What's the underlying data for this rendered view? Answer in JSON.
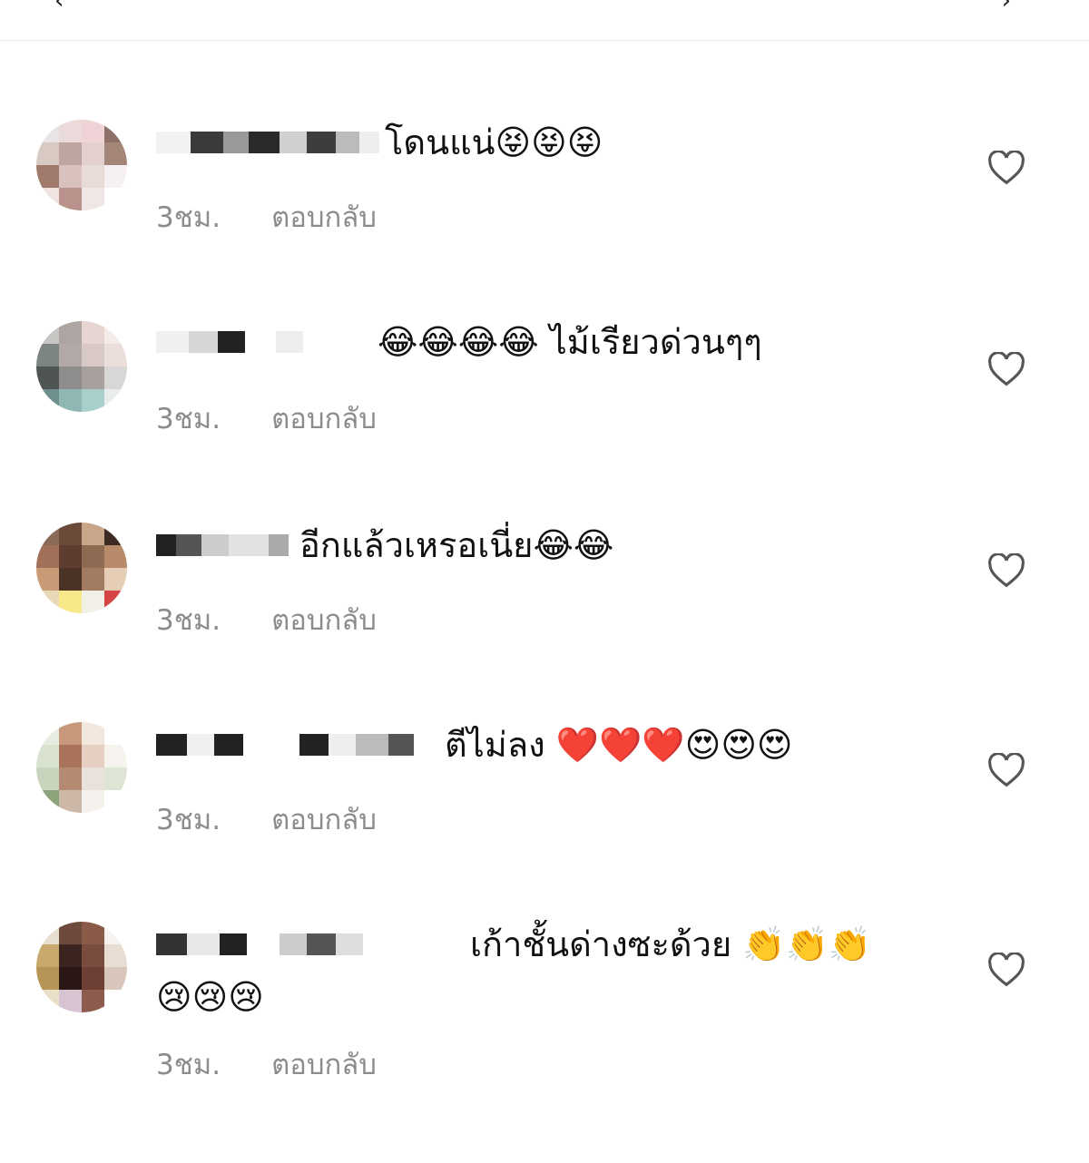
{
  "comments": [
    {
      "text": "โดนแน่😝😝😝",
      "time": "3ชม.",
      "reply_label": "ตอบกลับ"
    },
    {
      "text": "😂😂😂😂 ไม้เรียวด่วนๆๆ",
      "time": "3ชม.",
      "reply_label": "ตอบกลับ"
    },
    {
      "text": "อีกแล้วเหรอเนี่ย😂😂",
      "time": "3ชม.",
      "reply_label": "ตอบกลับ"
    },
    {
      "text": "ตีไม่ลง ❤️❤️❤️😍😍😍",
      "time": "3ชม.",
      "reply_label": "ตอบกลับ"
    },
    {
      "text": "เก้าชั้นด่างซะด้วย 👏👏👏😢😢😢",
      "time": "3ชม.",
      "reply_label": "ตอบกลับ"
    }
  ],
  "icons": {
    "like": "heart-outline-icon"
  },
  "colors": {
    "meta_text": "#8c8c8c",
    "divider": "#e6e6e6"
  }
}
